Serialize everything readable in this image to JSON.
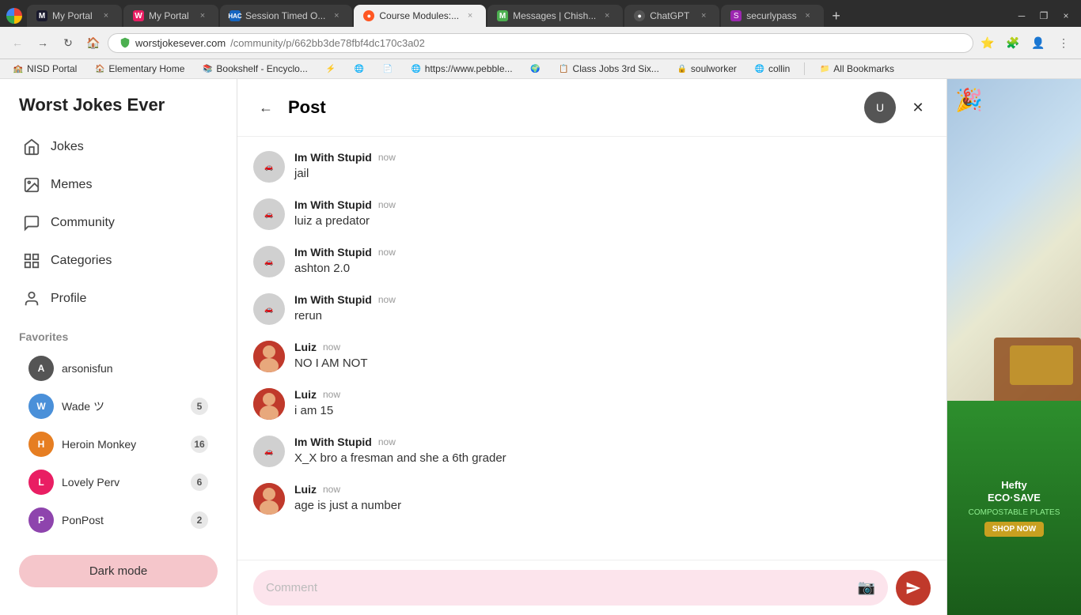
{
  "browser": {
    "tabs": [
      {
        "id": "tab-m",
        "favicon": "M",
        "favicon_bg": "#4285f4",
        "title": "My Portal",
        "active": false
      },
      {
        "id": "tab-w",
        "favicon": "W",
        "favicon_bg": "#e91e63",
        "title": "My Portal",
        "active": false
      },
      {
        "id": "tab-session",
        "favicon": "HAC",
        "favicon_bg": "#2196f3",
        "title": "Session Timed O...",
        "active": false
      },
      {
        "id": "tab-course",
        "favicon": "C",
        "favicon_bg": "#ff5722",
        "title": "Course Modules:...",
        "active": true
      },
      {
        "id": "tab-messages",
        "favicon": "M",
        "favicon_bg": "#4caf50",
        "title": "Messages | Chish...",
        "active": false
      },
      {
        "id": "tab-chatgpt",
        "favicon": "G",
        "favicon_bg": "#555",
        "title": "ChatGPT",
        "active": false
      },
      {
        "id": "tab-securly",
        "favicon": "S",
        "favicon_bg": "#9c27b0",
        "title": "securlypass",
        "active": false
      }
    ],
    "address": {
      "domain": "worstjokesever.com",
      "path": "/community/p/662bb3de78fbf4dc170c3a02"
    },
    "bookmarks": [
      {
        "label": "NISD Portal",
        "favicon": "🏫"
      },
      {
        "label": "Elementary Home",
        "favicon": "🏠"
      },
      {
        "label": "Bookshelf - Encyclo...",
        "favicon": "📚"
      },
      {
        "label": "",
        "favicon": "⚡"
      },
      {
        "label": "",
        "favicon": "🌐"
      },
      {
        "label": "",
        "favicon": "📄"
      },
      {
        "label": "https://www.pebble...",
        "favicon": "🌐"
      },
      {
        "label": "",
        "favicon": "🌍"
      },
      {
        "label": "Class Jobs 3rd Six...",
        "favicon": "📋"
      },
      {
        "label": "soulworker",
        "favicon": "🔒"
      },
      {
        "label": "collin",
        "favicon": "🌐"
      },
      {
        "label": "»",
        "favicon": ""
      },
      {
        "label": "All Bookmarks",
        "favicon": "📁"
      }
    ]
  },
  "sidebar": {
    "title": "Worst Jokes Ever",
    "nav_items": [
      {
        "id": "jokes",
        "label": "Jokes",
        "icon": "home"
      },
      {
        "id": "memes",
        "label": "Memes",
        "icon": "image"
      },
      {
        "id": "community",
        "label": "Community",
        "icon": "chat"
      },
      {
        "id": "categories",
        "label": "Categories",
        "icon": "grid"
      },
      {
        "id": "profile",
        "label": "Profile",
        "icon": "person"
      }
    ],
    "favorites_label": "Favorites",
    "favorites": [
      {
        "id": "arsonisfun",
        "name": "arsonisfun",
        "badge": null,
        "color": "av-dark"
      },
      {
        "id": "wade",
        "name": "Wade ツ",
        "badge": "5",
        "color": "av-blue"
      },
      {
        "id": "heroin-monkey",
        "name": "Heroin Monkey",
        "badge": "16",
        "color": "av-orange"
      },
      {
        "id": "lovely-perv",
        "name": "Lovely Perv",
        "badge": "6",
        "color": "av-pink"
      },
      {
        "id": "ponpost",
        "name": "PonPost",
        "badge": "2",
        "color": "av-purple"
      }
    ],
    "dark_mode_label": "Dark mode"
  },
  "post": {
    "title": "Post",
    "comments": [
      {
        "id": 1,
        "author": "Im With Stupid",
        "time": "now",
        "text": "jail",
        "avatar_type": "car"
      },
      {
        "id": 2,
        "author": "Im With Stupid",
        "time": "now",
        "text": "luiz a predator",
        "avatar_type": "car"
      },
      {
        "id": 3,
        "author": "Im With Stupid",
        "time": "now",
        "text": "ashton 2.0",
        "avatar_type": "car"
      },
      {
        "id": 4,
        "author": "Im With Stupid",
        "time": "now",
        "text": "rerun",
        "avatar_type": "car"
      },
      {
        "id": 5,
        "author": "Luiz",
        "time": "now",
        "text": "NO I AM NOT",
        "avatar_type": "luiz"
      },
      {
        "id": 6,
        "author": "Luiz",
        "time": "now",
        "text": "i am 15",
        "avatar_type": "luiz"
      },
      {
        "id": 7,
        "author": "Im With Stupid",
        "time": "now",
        "text": "X_X bro a fresman and she a 6th grader",
        "avatar_type": "car"
      },
      {
        "id": 8,
        "author": "Luiz",
        "time": "now",
        "text": "age is just a number",
        "avatar_type": "luiz"
      }
    ],
    "comment_placeholder": "Comment"
  }
}
